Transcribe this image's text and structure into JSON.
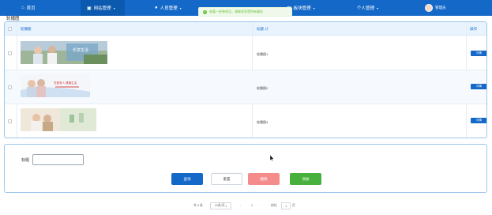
{
  "nav": {
    "items": [
      {
        "label": "首页",
        "icon": "home-icon",
        "glyph": "⌂"
      },
      {
        "label": "网站管理",
        "icon": "website-icon",
        "glyph": "▣"
      },
      {
        "label": "人员管理",
        "icon": "user-icon",
        "glyph": "👤"
      },
      {
        "label": "板块管理",
        "icon": "grid-icon",
        "glyph": "▦"
      },
      {
        "label": "个人管理",
        "icon": "profile-icon",
        "glyph": ""
      }
    ],
    "user": "管理员"
  },
  "toast": {
    "text": "恭喜一秒钟成功，请继续享受所有服务"
  },
  "breadcrumb": {
    "text": "轮播图"
  },
  "table": {
    "headers": {
      "image": "轮播图",
      "title": "标题",
      "action": "操作"
    },
    "rows": [
      {
        "title": "轮播图1",
        "action": "详情"
      },
      {
        "title": "轮播图2",
        "action": "详情"
      },
      {
        "title": "轮播图3",
        "action": "详情"
      }
    ]
  },
  "search": {
    "label": "标题",
    "value": "",
    "placeholder": ""
  },
  "buttons": {
    "query": "查询",
    "reset": "重置",
    "delete": "删除",
    "add": "添加"
  },
  "pagination": {
    "total": "共 3 条",
    "page_size": "10条/页",
    "prev": "‹",
    "current_page": "1",
    "next": "›",
    "goto_prefix": "前往",
    "goto_value": "1",
    "goto_suffix": "页"
  },
  "colors": {
    "primary": "#1469c8",
    "danger": "#f58c8c",
    "success": "#48b13e"
  }
}
